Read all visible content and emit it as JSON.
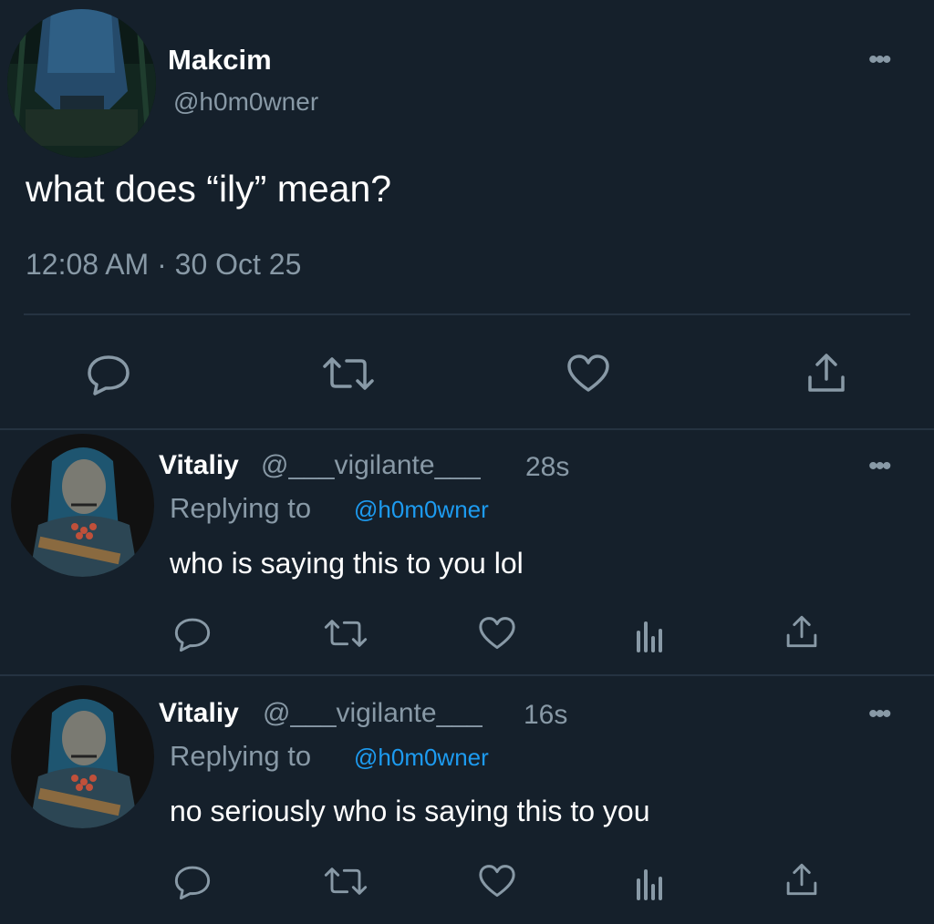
{
  "tweet": {
    "author_name": "Makcim",
    "author_handle": "@h0m0wner",
    "text": "what does “ily” mean?",
    "timestamp": "12:08 AM · 30 Oct 25"
  },
  "replies": [
    {
      "author_name": "Vitaliy",
      "author_handle": "@___vigilante___",
      "time": "28s",
      "replying_label": "Replying to",
      "replying_to": "@h0m0wner",
      "text": "who is saying this to you lol"
    },
    {
      "author_name": "Vitaliy",
      "author_handle": "@___vigilante___",
      "time": "16s",
      "replying_label": "Replying to",
      "replying_to": "@h0m0wner",
      "text": "no seriously who is saying this to you"
    }
  ],
  "icons": [
    "reply-icon",
    "retweet-icon",
    "like-icon",
    "share-icon",
    "analytics-icon",
    "more-icon"
  ],
  "colors": {
    "background": "#15202b",
    "muted": "#8899a6",
    "link": "#1d9bf0",
    "divider": "#253341"
  }
}
